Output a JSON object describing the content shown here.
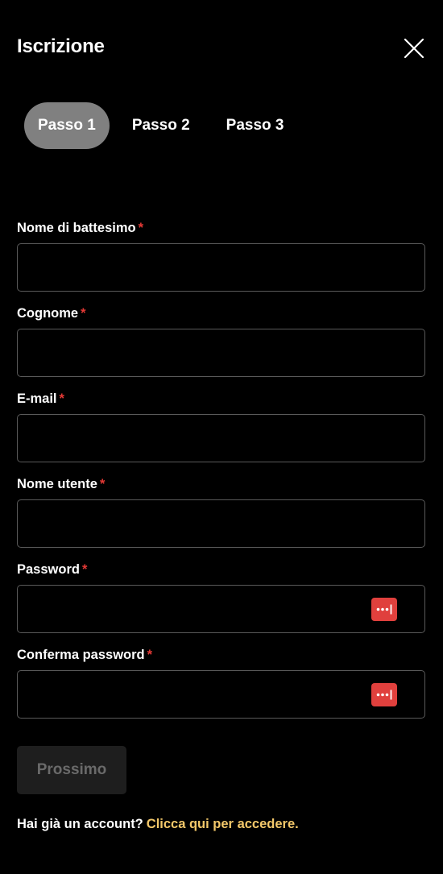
{
  "header": {
    "title": "Iscrizione"
  },
  "steps": [
    {
      "label": "Passo 1",
      "active": true
    },
    {
      "label": "Passo 2",
      "active": false
    },
    {
      "label": "Passo 3",
      "active": false
    }
  ],
  "form": {
    "required_mark": "*",
    "first_name": {
      "label": "Nome di battesimo",
      "value": ""
    },
    "last_name": {
      "label": "Cognome",
      "value": ""
    },
    "email": {
      "label": "E-mail",
      "value": ""
    },
    "username": {
      "label": "Nome utente",
      "value": ""
    },
    "password": {
      "label": "Password",
      "value": "",
      "icon": "password-manager-icon"
    },
    "confirm_password": {
      "label": "Conferma password",
      "value": "",
      "icon": "password-manager-icon"
    }
  },
  "actions": {
    "next_label": "Prossimo",
    "next_disabled": true
  },
  "footer": {
    "prompt": "Hai già un account?",
    "link": "Clicca qui per accedere."
  },
  "colors": {
    "background": "#000000",
    "active_step": "#808080",
    "required": "#e53935",
    "link": "#f3c86a",
    "password_icon": "#e0403d",
    "button_disabled_bg": "#1e1e1e",
    "button_disabled_text": "#6a6a6a"
  }
}
